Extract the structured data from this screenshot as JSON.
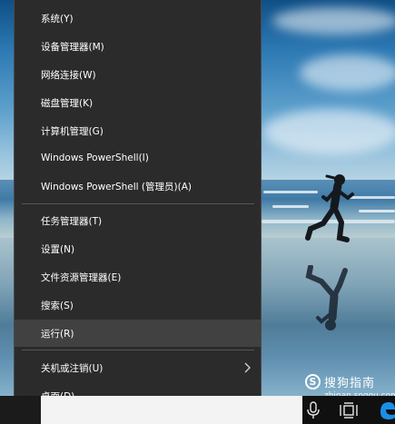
{
  "menu": {
    "items": [
      {
        "label": "系统(Y)"
      },
      {
        "label": "设备管理器(M)"
      },
      {
        "label": "网络连接(W)"
      },
      {
        "label": "磁盘管理(K)"
      },
      {
        "label": "计算机管理(G)"
      },
      {
        "label": "Windows PowerShell(I)"
      },
      {
        "label": "Windows PowerShell (管理员)(A)"
      },
      {
        "label": "任务管理器(T)"
      },
      {
        "label": "设置(N)"
      },
      {
        "label": "文件资源管理器(E)"
      },
      {
        "label": "搜索(S)"
      },
      {
        "label": "运行(R)"
      },
      {
        "label": "关机或注销(U)"
      },
      {
        "label": "桌面(D)"
      }
    ],
    "highlighted_item": "运行(R)",
    "submenu_arrow_icon": "chevron-right-icon"
  },
  "taskbar": {
    "icons": [
      "microphone-icon",
      "task-view-icon",
      "edge-browser-icon"
    ]
  },
  "watermark": {
    "brand_text": "搜狗指南",
    "site_text": "zhinan.sogou.com"
  },
  "colors": {
    "menu_background": "#2b2b2b",
    "menu_highlight": "#414141",
    "menu_text": "#ffffff",
    "taskbar": "#101010"
  }
}
